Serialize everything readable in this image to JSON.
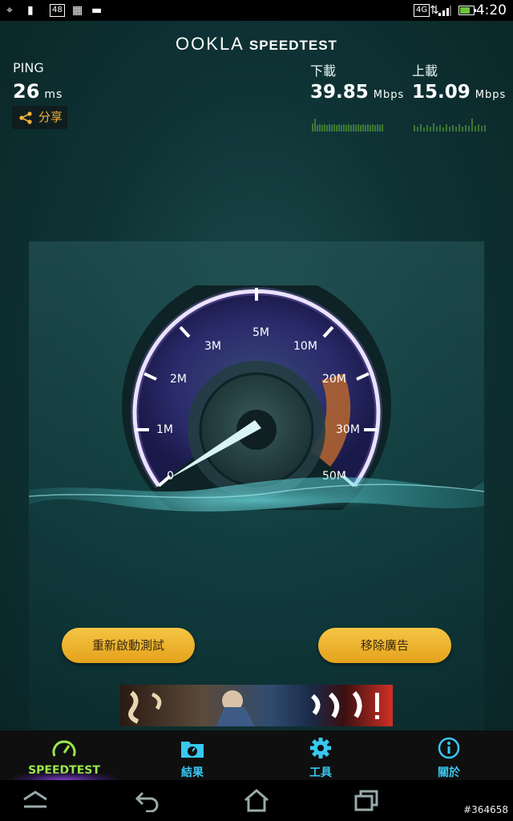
{
  "status_bar": {
    "time": "4:20",
    "badge_48": "48",
    "network": "4G"
  },
  "app": {
    "logo_ookla": "OOKLA",
    "logo_speedtest": "SPEEDTEST",
    "ping": {
      "label": "PING",
      "value": "26",
      "unit": "ms"
    },
    "share_label": "分享",
    "download": {
      "label": "下載",
      "value": "39.85",
      "unit": "Mbps"
    },
    "upload": {
      "label": "上載",
      "value": "15.09",
      "unit": "Mbps"
    },
    "gauge": {
      "ticks": [
        "0",
        "1M",
        "2M",
        "3M",
        "5M",
        "10M",
        "20M",
        "30M",
        "50M"
      ],
      "accent_arc_color": "#e0862e",
      "scale_color": "#ffffff"
    },
    "restart_button": "重新啟動測試",
    "remove_ads_button": "移除廣告"
  },
  "tabs": [
    {
      "label": "SPEEDTEST",
      "icon": "gauge-icon",
      "active": true
    },
    {
      "label": "結果",
      "icon": "results-folder-icon",
      "active": false
    },
    {
      "label": "工具",
      "icon": "gear-icon",
      "active": false
    },
    {
      "label": "關於",
      "icon": "info-icon",
      "active": false
    }
  ],
  "watermark": "#364658",
  "colors": {
    "accent_green": "#9be84a",
    "tab_blue": "#38c8f0",
    "button_gold": "#f0b733"
  }
}
